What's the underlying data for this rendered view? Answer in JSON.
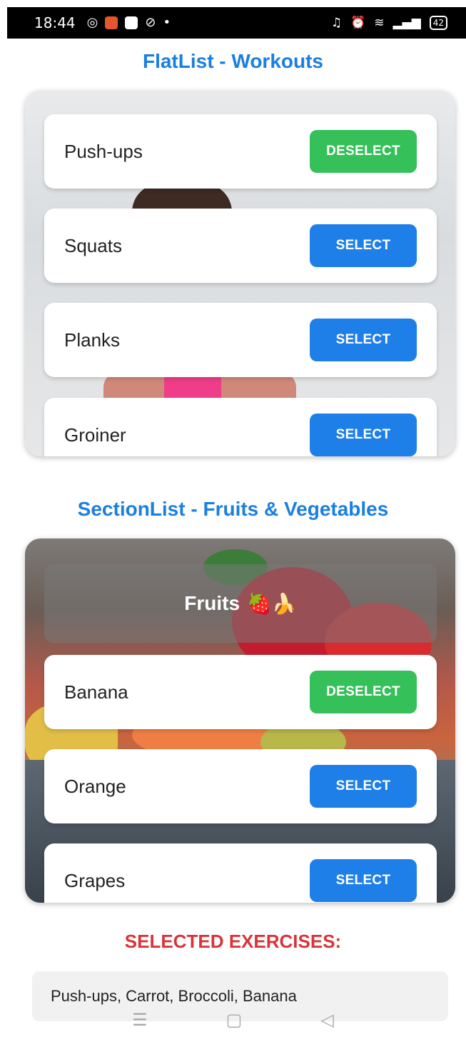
{
  "status_bar": {
    "time": "18:44",
    "battery": "42"
  },
  "flatlist": {
    "title": "FlatList - Workouts",
    "items": [
      {
        "label": "Push-ups",
        "button": "DESELECT"
      },
      {
        "label": "Squats",
        "button": "SELECT"
      },
      {
        "label": "Planks",
        "button": "SELECT"
      },
      {
        "label": "Groiner",
        "button": "SELECT"
      }
    ]
  },
  "sectionlist": {
    "title": "SectionList - Fruits & Vegetables",
    "section_header": "Fruits",
    "section_emoji": "🍓🍌",
    "items": [
      {
        "label": "Banana",
        "button": "DESELECT"
      },
      {
        "label": "Orange",
        "button": "SELECT"
      },
      {
        "label": "Grapes",
        "button": "SELECT"
      }
    ]
  },
  "selected": {
    "title": "SELECTED EXERCISES:",
    "value": "Push-ups, Carrot, Broccoli, Banana"
  },
  "colors": {
    "title_blue": "#1a7fe0",
    "select_blue": "#1f7fe8",
    "deselect_green": "#35c05a",
    "selected_red": "#d9343a"
  },
  "icons": [
    "instagram-icon",
    "app-notification-icon",
    "gallery-icon",
    "check-circle-icon",
    "dnd-icon",
    "alarm-icon",
    "wifi-icon",
    "signal-icon",
    "battery-icon",
    "menu-nav-icon",
    "home-nav-icon",
    "back-nav-icon"
  ]
}
